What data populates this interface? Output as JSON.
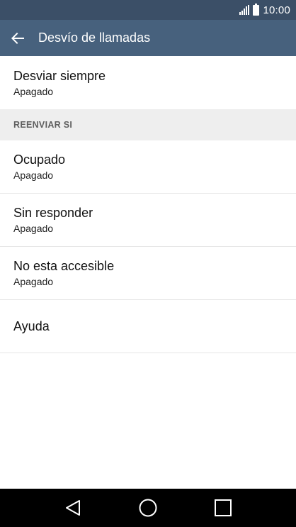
{
  "status_bar": {
    "time": "10:00",
    "icons": [
      "signal-icon",
      "battery-icon"
    ]
  },
  "app_bar": {
    "back_icon": "arrow-left-icon",
    "title": "Desvío de llamadas"
  },
  "settings": {
    "always_forward": {
      "title": "Desviar siempre",
      "status": "Apagado"
    },
    "section_header": "REENVIAR SI",
    "items": [
      {
        "title": "Ocupado",
        "status": "Apagado"
      },
      {
        "title": "Sin responder",
        "status": "Apagado"
      },
      {
        "title": "No esta accesible",
        "status": "Apagado"
      }
    ],
    "help": {
      "title": "Ayuda"
    }
  },
  "nav_bar": {
    "icons": [
      "back-triangle-icon",
      "home-circle-icon",
      "recents-square-icon"
    ]
  },
  "colors": {
    "status_bar": "#3b4f67",
    "app_bar": "#47617d",
    "section_header_bg": "#eeeeee",
    "nav_bar": "#000000"
  }
}
